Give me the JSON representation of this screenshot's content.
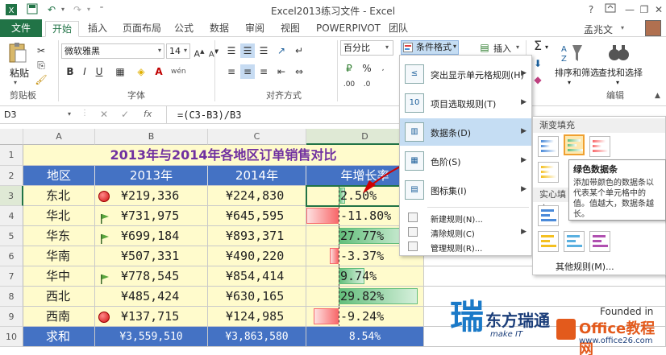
{
  "window": {
    "title": "Excel2013练习文件 - Excel",
    "help": "?",
    "user": "孟兆文"
  },
  "tabs": [
    {
      "label": "文件"
    },
    {
      "label": "开始"
    },
    {
      "label": "插入"
    },
    {
      "label": "页面布局"
    },
    {
      "label": "公式"
    },
    {
      "label": "数据"
    },
    {
      "label": "审阅"
    },
    {
      "label": "视图"
    },
    {
      "label": "POWERPIVOT"
    },
    {
      "label": "团队"
    }
  ],
  "ribbon": {
    "paste": "粘贴",
    "clipboard": "剪贴板",
    "font_name": "微软雅黑",
    "font_size": "14",
    "font_group": "字体",
    "bold": "B",
    "italic": "I",
    "underline": "U",
    "align_group": "对齐方式",
    "number_format": "百分比",
    "cond_format": "条件格式",
    "insert": "插入",
    "sort_filter": "排序和筛选",
    "find_select": "查找和选择",
    "edit_group": "编辑",
    "percent": "%"
  },
  "formula_bar": {
    "name_box": "D3",
    "fx": "fx",
    "formula": "=(C3-B3)/B3"
  },
  "columns": [
    "A",
    "B",
    "C",
    "D"
  ],
  "rows": [
    "1",
    "2",
    "3",
    "4",
    "5",
    "6",
    "7",
    "8",
    "9",
    "10"
  ],
  "sheet": {
    "title": "2013年与2014年各地区订单销售对比",
    "headers": [
      "地区",
      "2013年",
      "2014年",
      "年增长率"
    ],
    "data": [
      {
        "region": "东北",
        "y2013": "¥219,336",
        "y2014": "¥224,830",
        "growth": "2.50%",
        "icon": "red-circle",
        "pct": 2.5
      },
      {
        "region": "华北",
        "y2013": "¥731,975",
        "y2014": "¥645,595",
        "growth": "-11.80%",
        "icon": "green-flag",
        "pct": -11.8
      },
      {
        "region": "华东",
        "y2013": "¥699,184",
        "y2014": "¥893,371",
        "growth": "27.77%",
        "icon": "green-flag",
        "pct": 27.77
      },
      {
        "region": "华南",
        "y2013": "¥507,331",
        "y2014": "¥490,220",
        "growth": "-3.37%",
        "icon": "none",
        "pct": -3.37
      },
      {
        "region": "华中",
        "y2013": "¥778,545",
        "y2014": "¥854,414",
        "growth": "9.74%",
        "icon": "green-flag",
        "pct": 9.74
      },
      {
        "region": "西北",
        "y2013": "¥485,424",
        "y2014": "¥630,165",
        "growth": "29.82%",
        "icon": "none",
        "pct": 29.82
      },
      {
        "region": "西南",
        "y2013": "¥137,715",
        "y2014": "¥124,985",
        "growth": "-9.24%",
        "icon": "red-circle",
        "pct": -9.24
      }
    ],
    "total": {
      "label": "求和",
      "y2013": "¥3,559,510",
      "y2014": "¥3,863,580",
      "growth": "8.54%"
    }
  },
  "menu": {
    "items": [
      {
        "label": "突出显示单元格规则(H)",
        "arrow": "▶",
        "icon": "highlight-rules-icon"
      },
      {
        "label": "项目选取规则(T)",
        "arrow": "▶",
        "icon": "top-bottom-rules-icon"
      },
      {
        "label": "数据条(D)",
        "arrow": "▶",
        "icon": "data-bars-icon"
      },
      {
        "label": "色阶(S)",
        "arrow": "▶",
        "icon": "color-scales-icon"
      },
      {
        "label": "图标集(I)",
        "arrow": "▶",
        "icon": "icon-sets-icon"
      }
    ],
    "small_items": [
      {
        "label": "新建规则(N)..."
      },
      {
        "label": "清除规则(C)",
        "arrow": "▶"
      },
      {
        "label": "管理规则(R)..."
      }
    ]
  },
  "submenu": {
    "gradient_header": "渐变填充",
    "solid_header": "实心填充",
    "more_rules": "其他规则(M)..."
  },
  "tooltip": {
    "title": "绿色数据条",
    "body": "添加带颜色的数据条以代表某个单元格中的值。值越大，数据条越长。"
  },
  "watermark": {
    "brand": "东方瑞通",
    "sub": "make IT",
    "site": "Office教程网",
    "domain": "www.office26.com",
    "founded": "Founded in"
  },
  "colors": {
    "excel_green": "#217346",
    "header_blue": "#4472c4",
    "row_yellow": "#fffbcc",
    "bar_green": "#63be7b",
    "bar_red": "#f8696b",
    "title_purple": "#7030a0"
  }
}
